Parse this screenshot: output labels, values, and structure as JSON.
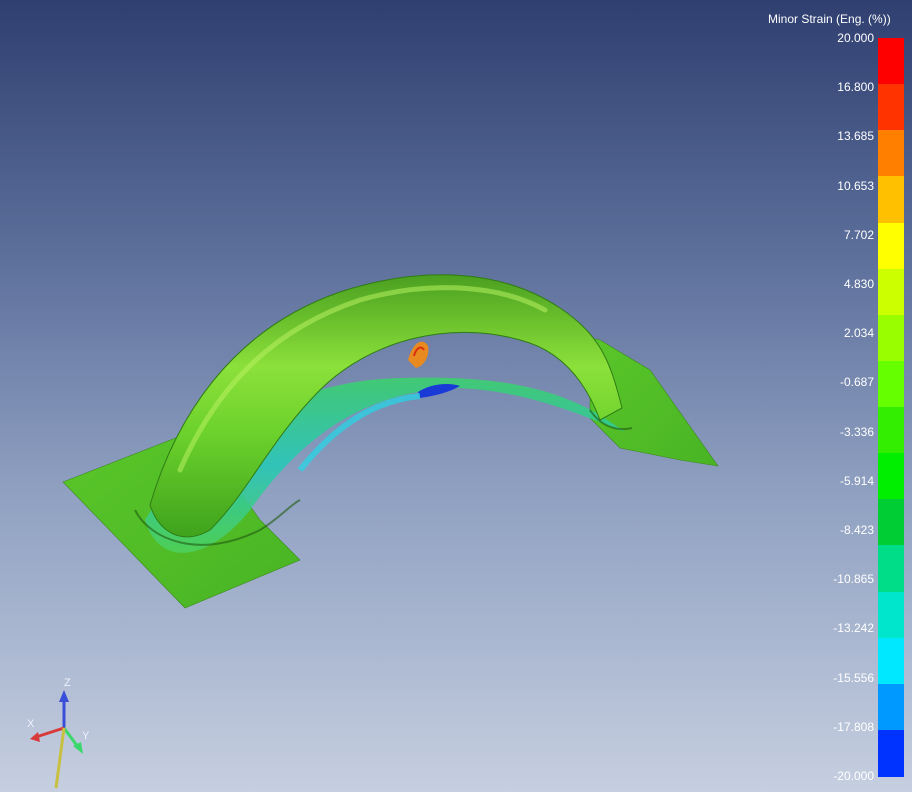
{
  "legend": {
    "title": "Minor Strain (Eng. (%))",
    "ticks": [
      "20.000",
      "16.800",
      "13.685",
      "10.653",
      "7.702",
      "4.830",
      "2.034",
      "-0.687",
      "-3.336",
      "-5.914",
      "-8.423",
      "-10.865",
      "-13.242",
      "-15.556",
      "-17.808",
      "-20.000"
    ],
    "band_colors": [
      "#ff0000",
      "#ff3300",
      "#ff8000",
      "#ffc000",
      "#ffff00",
      "#ccff00",
      "#99ff00",
      "#66ff00",
      "#33ee00",
      "#00ee00",
      "#00cc33",
      "#00dd88",
      "#00e6cc",
      "#00e8ff",
      "#0099ff",
      "#0033ff"
    ]
  },
  "axes": {
    "z_label": "Z",
    "x_label": "X",
    "y_label": "Y",
    "z_color": "#3a4fd8",
    "x_color": "#d83a3a",
    "y_color": "#3ad86a"
  },
  "colors": {
    "background_top": "#2f3f70",
    "background_bottom": "#c6cfe0",
    "part_base": "#5ec62a"
  }
}
